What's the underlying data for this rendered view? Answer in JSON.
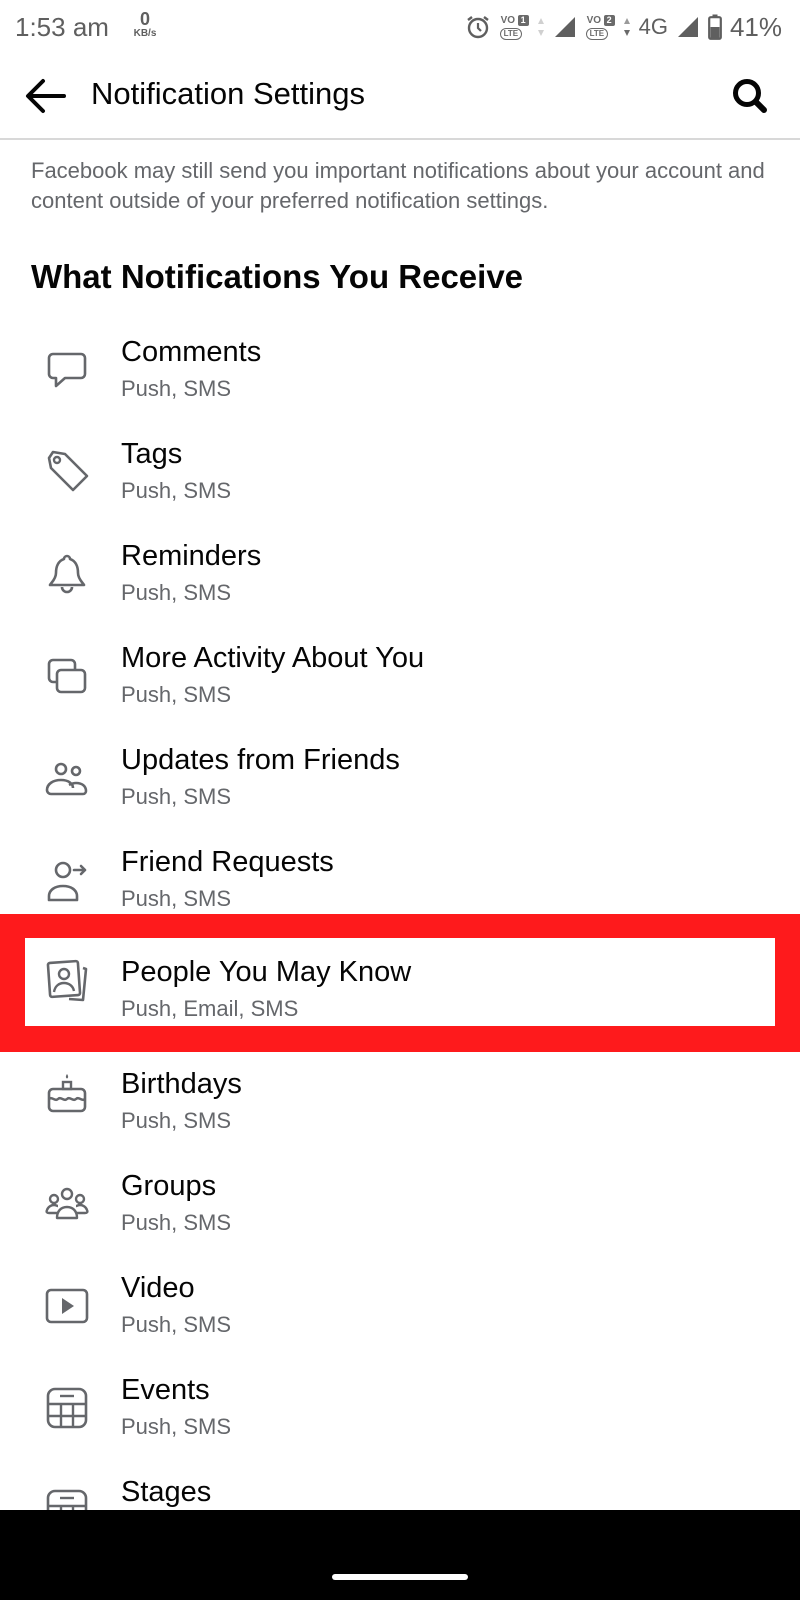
{
  "status_bar": {
    "time": "1:53 am",
    "net_speed_value": "0",
    "net_speed_unit": "KB/s",
    "sim1_label": "VO",
    "sim1_num": "1",
    "sim1_lte": "LTE",
    "sim2_label": "VO",
    "sim2_num": "2",
    "sim2_lte": "LTE",
    "network_type": "4G",
    "battery_percent": "41%"
  },
  "header": {
    "title": "Notification Settings",
    "back_icon": "arrow-left-icon",
    "search_icon": "search-icon"
  },
  "disclaimer": "Facebook may still send you important notifications about your account and content outside of your preferred notification settings.",
  "section_title": "What Notifications You Receive",
  "items": [
    {
      "label": "Comments",
      "channels": "Push, SMS",
      "icon": "comment-bubble-icon"
    },
    {
      "label": "Tags",
      "channels": "Push, SMS",
      "icon": "tag-icon"
    },
    {
      "label": "Reminders",
      "channels": "Push, SMS",
      "icon": "bell-icon"
    },
    {
      "label": "More Activity About You",
      "channels": "Push, SMS",
      "icon": "stacked-cards-icon"
    },
    {
      "label": "Updates from Friends",
      "channels": "Push, SMS",
      "icon": "friends-icon"
    },
    {
      "label": "Friend Requests",
      "channels": "Push, SMS",
      "icon": "friend-request-icon"
    },
    {
      "label": "People You May Know",
      "channels": "Push, Email, SMS",
      "icon": "contact-card-icon",
      "highlighted": true
    },
    {
      "label": "Birthdays",
      "channels": "Push, SMS",
      "icon": "birthday-cake-icon"
    },
    {
      "label": "Groups",
      "channels": "Push, SMS",
      "icon": "groups-icon"
    },
    {
      "label": "Video",
      "channels": "Push, SMS",
      "icon": "video-play-icon"
    },
    {
      "label": "Events",
      "channels": "Push, SMS",
      "icon": "calendar-icon"
    },
    {
      "label": "Stages",
      "channels": "",
      "icon": "calendar-icon"
    }
  ],
  "colors": {
    "highlight": "#fe1a1c",
    "icon_gray": "#65676b",
    "text_primary": "#050505",
    "text_secondary": "#65676b"
  }
}
